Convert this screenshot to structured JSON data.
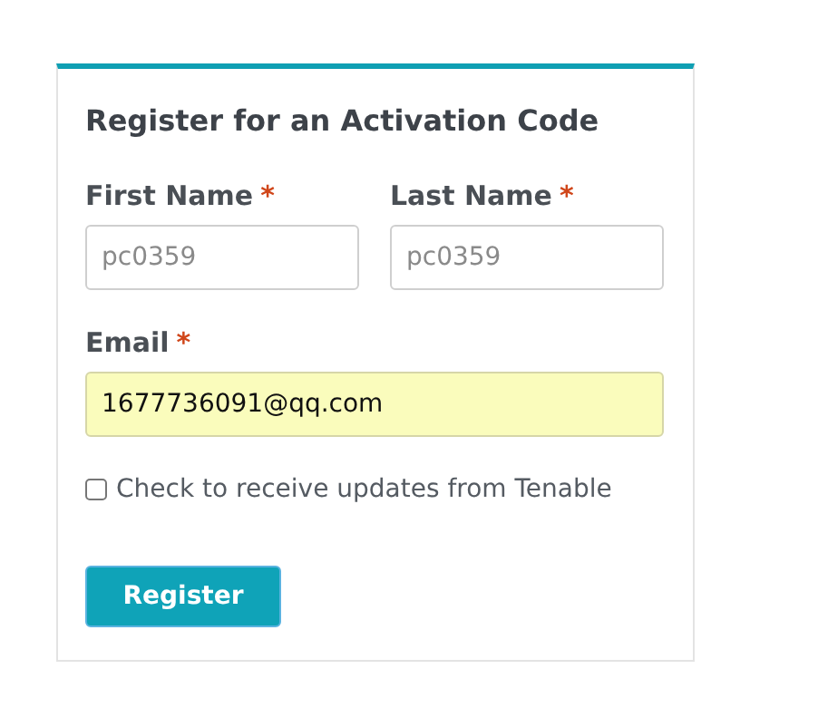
{
  "form": {
    "title": "Register for an Activation Code",
    "name_fields": [
      {
        "label": "First Name",
        "required_mark": "*",
        "placeholder": "pc0359"
      },
      {
        "label": "Last Name",
        "required_mark": "*",
        "placeholder": "pc0359"
      }
    ],
    "email": {
      "label": "Email",
      "required_mark": "*",
      "value": "1677736091@qq.com"
    },
    "updates_checkbox": {
      "label": "Check to receive updates from Tenable",
      "checked": false
    },
    "submit_button": "Register"
  }
}
